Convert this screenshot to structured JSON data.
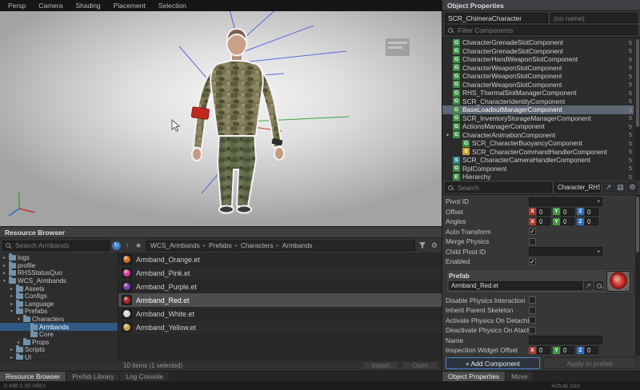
{
  "menubar": {
    "items": [
      "Persp",
      "Camera",
      "Shading",
      "Placement",
      "Selection"
    ]
  },
  "object_properties": {
    "title": "Object Properties",
    "entity_class": "SCR_ChimeraCharacter",
    "entity_name_placeholder": "(no name)",
    "filter_placeholder": "Filter Components",
    "axis_colors": {
      "x": "#b03a2e",
      "y": "#3f9b43",
      "z": "#2f6fbf"
    },
    "components": [
      {
        "label": "CharacterGrenadeSlotComponent",
        "count": "5",
        "icon": "G",
        "icon_color": "#3e9141"
      },
      {
        "label": "CharacterGrenadeSlotComponent",
        "count": "5",
        "icon": "G",
        "icon_color": "#3e9141"
      },
      {
        "label": "CharacterHandWeaponSlotComponent",
        "count": "5",
        "icon": "G",
        "icon_color": "#3e9141"
      },
      {
        "label": "CharacterWeaponSlotComponent",
        "count": "5",
        "icon": "G",
        "icon_color": "#3e9141"
      },
      {
        "label": "CharacterWeaponSlotComponent",
        "count": "5",
        "icon": "G",
        "icon_color": "#3e9141"
      },
      {
        "label": "CharacterWeaponSlotComponent",
        "count": "5",
        "icon": "G",
        "icon_color": "#3e9141"
      },
      {
        "label": "RHS_ThermalSlotManagerComponent",
        "count": "5",
        "icon": "G",
        "icon_color": "#3e9141"
      },
      {
        "label": "SCR_CharacterIdentityComponent",
        "count": "5",
        "icon": "G",
        "icon_color": "#3e9141"
      },
      {
        "label": "BaseLoadoutManagerComponent",
        "count": "5",
        "icon": "G",
        "icon_color": "#3e9141",
        "selected": true
      },
      {
        "label": "SCR_InventoryStorageManagerComponent",
        "count": "5",
        "icon": "G",
        "icon_color": "#3e9141"
      },
      {
        "label": "ActionsManagerComponent",
        "count": "5",
        "icon": "G",
        "icon_color": "#3e9141"
      },
      {
        "label": "CharacterAnimationComponent",
        "count": "5",
        "icon": "G",
        "icon_color": "#3e9141",
        "arrow": "expanded"
      },
      {
        "label": "SCR_CharacterBuoyancyComponent",
        "count": "5",
        "icon": "G",
        "icon_color": "#3e9141",
        "indent": 1
      },
      {
        "label": "SCR_CharacterCommandHandlerComponent",
        "count": "5",
        "icon": "S",
        "icon_color": "#c9a227",
        "indent": 1
      },
      {
        "label": "SCR_CharacterCameraHandlerComponent",
        "count": "5",
        "icon": "S",
        "icon_color": "#2e8b8b"
      },
      {
        "label": "RplComponent",
        "count": "5",
        "icon": "G",
        "icon_color": "#3e9141"
      },
      {
        "label": "Hierarchy",
        "count": "5",
        "icon": "E",
        "icon_color": "#3e9141"
      }
    ],
    "toolbar": {
      "search_placeholder": "Search",
      "context": "Character_RHS_RF_SSO_Base",
      "icons": [
        {
          "name": "export-icon",
          "glyph": "↗"
        },
        {
          "name": "tree-icon",
          "glyph": "▤"
        },
        {
          "name": "gear-icon",
          "glyph": "⚙"
        }
      ]
    },
    "props_top": [
      {
        "label": "Pivot ID",
        "type": "dropdown"
      },
      {
        "label": "Offset",
        "type": "xyz",
        "values": [
          "0",
          "0",
          "0"
        ]
      },
      {
        "label": "Angles",
        "type": "xyz",
        "values": [
          "0",
          "0",
          "0"
        ]
      },
      {
        "label": "Auto Transform",
        "type": "checkbox",
        "checked": true
      },
      {
        "label": "Merge Physics",
        "type": "checkbox",
        "checked": false
      },
      {
        "label": "Child Pivot ID",
        "type": "dropdown"
      },
      {
        "label": "Enabled",
        "type": "checkbox",
        "checked": true
      }
    ],
    "prefab": {
      "label": "Prefab",
      "value": "Armband_Red.et",
      "color": "#b62525"
    },
    "props_bottom": [
      {
        "label": "Disable Physics Interaction",
        "type": "checkbox",
        "checked": false
      },
      {
        "label": "Inherit Parent Skeleton",
        "type": "checkbox",
        "checked": false
      },
      {
        "label": "Activate Physics On Detaching",
        "type": "checkbox",
        "checked": false
      },
      {
        "label": "Deactivate Physics On Ataching",
        "type": "checkbox",
        "checked": false
      },
      {
        "label": "Name",
        "type": "text",
        "value": ""
      },
      {
        "label": "Inspection Widget Offset",
        "type": "xyz",
        "values": [
          "0",
          "0",
          "0"
        ]
      }
    ],
    "add_component_label": "+ Add Component",
    "apply_label": "Apply to prefab",
    "tabs": [
      {
        "label": "Object Properties",
        "active": true
      },
      {
        "label": "Move",
        "active": false
      }
    ]
  },
  "resource_browser": {
    "title": "Resource Browser",
    "search_placeholder": "Search Armbands",
    "toolbar_icons": [
      {
        "name": "sync-icon",
        "glyph": "↻"
      },
      {
        "name": "up-icon",
        "glyph": "↑"
      },
      {
        "name": "favorite-star-icon",
        "glyph": "★"
      }
    ],
    "breadcrumb": [
      "WCS_Armbands",
      "Prefabs",
      "Characters",
      "Armbands"
    ],
    "tree": [
      {
        "label": "logs",
        "indent": 0,
        "arrow": "collapsed"
      },
      {
        "label": "profile",
        "indent": 0,
        "arrow": "collapsed"
      },
      {
        "label": "RHSStatusQuo",
        "indent": 0,
        "arrow": "collapsed"
      },
      {
        "label": "WCS_Armbands",
        "indent": 0,
        "arrow": "expanded"
      },
      {
        "label": "Assets",
        "indent": 1,
        "arrow": "collapsed"
      },
      {
        "label": "Configs",
        "indent": 1,
        "arrow": "collapsed"
      },
      {
        "label": "Language",
        "indent": 1,
        "arrow": "collapsed"
      },
      {
        "label": "Prefabs",
        "indent": 1,
        "arrow": "expanded"
      },
      {
        "label": "Characters",
        "indent": 2,
        "arrow": "expanded"
      },
      {
        "label": "Armbands",
        "indent": 3,
        "arrow": "none",
        "selected": true
      },
      {
        "label": "Core",
        "indent": 3,
        "arrow": "none"
      },
      {
        "label": "Props",
        "indent": 2,
        "arrow": "collapsed"
      },
      {
        "label": "Scripts",
        "indent": 1,
        "arrow": "collapsed"
      },
      {
        "label": "UI",
        "indent": 1,
        "arrow": "collapsed"
      }
    ],
    "files": [
      {
        "name": "Armband_Orange.et",
        "color": "#d4731c"
      },
      {
        "name": "Armband_Pink.et",
        "color": "#d8439a"
      },
      {
        "name": "Armband_Purple.et",
        "color": "#7e3fae"
      },
      {
        "name": "Armband_Red.et",
        "color": "#b62525",
        "selected": true
      },
      {
        "name": "Armband_White.et",
        "color": "#d8d8d8"
      },
      {
        "name": "Armband_Yellow.et",
        "color": "#c2a84e"
      }
    ],
    "status": "10 items (1 selected)",
    "action_buttons": [
      {
        "label": "Import",
        "enabled": false
      },
      {
        "label": "Open",
        "enabled": false
      }
    ],
    "tabs": [
      {
        "label": "Resource Browser",
        "active": true
      },
      {
        "label": "Prefab Library",
        "active": false
      },
      {
        "label": "Log Console",
        "active": false
      }
    ]
  },
  "statusbar": {
    "left": "0 MB   0.00 MB/s",
    "right": "Actual size"
  }
}
